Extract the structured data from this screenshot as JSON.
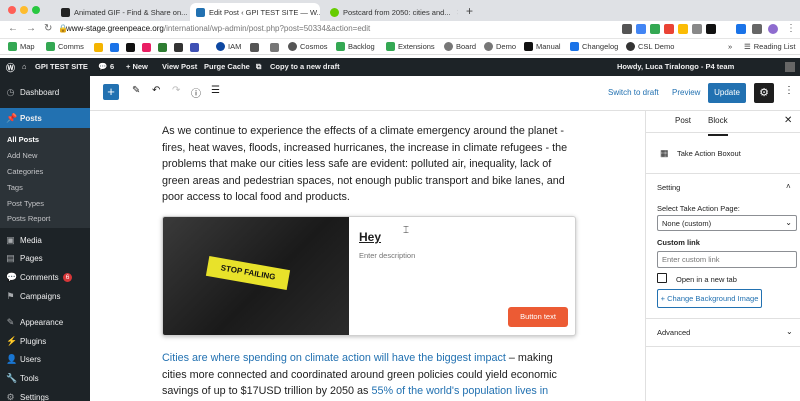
{
  "browser": {
    "tabs": [
      {
        "title": "Animated GIF - Find & Share on...",
        "active": false
      },
      {
        "title": "Edit Post ‹ GPI TEST SITE — W...",
        "active": true
      },
      {
        "title": "Postcard from 2050: cities and...",
        "active": false
      }
    ],
    "url_host": "www-stage.greenpeace.org",
    "url_path": "/international/wp-admin/post.php?post=50334&action=edit",
    "bookmarks": [
      "Map",
      "Comms",
      "IAM",
      "Cosmos",
      "Backlog",
      "Extensions",
      "Board",
      "Demo",
      "Manual",
      "Changelog",
      "CSL Demo"
    ],
    "reading_list": "Reading List"
  },
  "adminbar": {
    "site": "GPI TEST SITE",
    "comments_count": "6",
    "new": "+ New",
    "view_post": "View Post",
    "purge": "Purge Cache",
    "copy": "Copy to a new draft",
    "howdy": "Howdy, Luca Tiralongo - P4 team"
  },
  "sidebar": {
    "dashboard": "Dashboard",
    "posts": "Posts",
    "sub": [
      "All Posts",
      "Add New",
      "Categories",
      "Tags",
      "Post Types",
      "Posts Report"
    ],
    "media": "Media",
    "pages": "Pages",
    "comments": "Comments",
    "comments_badge": "6",
    "campaigns": "Campaigns",
    "appearance": "Appearance",
    "plugins": "Plugins",
    "users": "Users",
    "tools": "Tools",
    "settings": "Settings"
  },
  "toolbar": {
    "switch_to_draft": "Switch to draft",
    "preview": "Preview",
    "update": "Update"
  },
  "content": {
    "para1": "As we continue to experience the effects of a climate emergency around the planet - fires, heat waves, floods, increased hurricanes, the increase in climate refugees - the problems that make our cities less safe are evident: polluted air, inequality, lack of green areas and pedestrian spaces, not enough public transport and bike lanes, and poor access to local food and products.",
    "card_title": "Hey",
    "card_desc": "Enter description",
    "card_button": "Button text",
    "banner_text": "STOP FAILING",
    "link1": "Cities are where spending on climate action will have the biggest impact",
    "para2_mid": " – making cities more connected and coordinated around green policies could yield economic savings of up to $17USD trillion by 2050 as ",
    "link2": "55% of the world's population lives in"
  },
  "panel": {
    "tab_post": "Post",
    "tab_block": "Block",
    "block_name": "Take Action Boxout",
    "setting": "Setting",
    "select_label": "Select Take Action Page:",
    "select_value": "None (custom)",
    "custom_link_label": "Custom link",
    "custom_link_placeholder": "Enter custom link",
    "new_tab_label": "Open in a new tab",
    "change_bg": "+ Change Background Image",
    "advanced": "Advanced"
  }
}
